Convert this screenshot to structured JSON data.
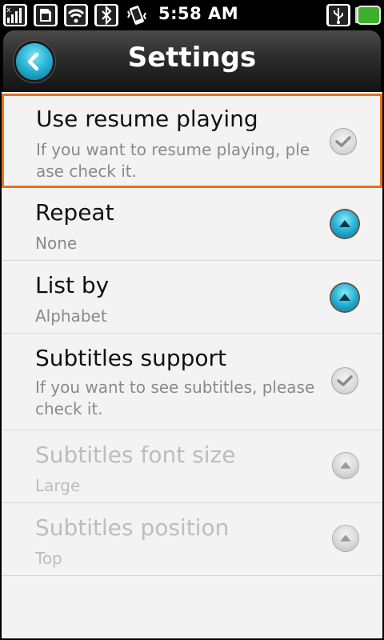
{
  "status_bar": {
    "time": "5:58 AM",
    "icons": [
      "signal-icon",
      "sim-icon",
      "wifi-icon",
      "bluetooth-icon",
      "vibrate-icon",
      "usb-icon",
      "battery-icon"
    ]
  },
  "header": {
    "title": "Settings",
    "back_icon": "back-arrow-icon",
    "accent_color": "#2bb6d9"
  },
  "settings": [
    {
      "title": "Use resume playing",
      "subtitle": "If you want to resume playing, please check it.",
      "subtitle_lines": [
        "If you want to resume playing, ple",
        "ase check it."
      ],
      "control": "checkbox",
      "enabled": true,
      "selected": true
    },
    {
      "title": "Repeat",
      "subtitle": "None",
      "subtitle_lines": [
        "None"
      ],
      "control": "dropdown",
      "enabled": true,
      "selected": false
    },
    {
      "title": "List by",
      "subtitle": "Alphabet",
      "subtitle_lines": [
        "Alphabet"
      ],
      "control": "dropdown",
      "enabled": true,
      "selected": false
    },
    {
      "title": "Subtitles support",
      "subtitle": "If you want to see subtitles, please check it.",
      "subtitle_lines": [
        "If you want to see subtitles, please",
        "check it."
      ],
      "control": "checkbox",
      "enabled": true,
      "selected": false
    },
    {
      "title": "Subtitles font size",
      "subtitle": "Large",
      "subtitle_lines": [
        "Large"
      ],
      "control": "dropdown",
      "enabled": false,
      "selected": false
    },
    {
      "title": "Subtitles position",
      "subtitle": "Top",
      "subtitle_lines": [
        "Top"
      ],
      "control": "dropdown",
      "enabled": false,
      "selected": false
    }
  ],
  "colors": {
    "selection_border": "#e8711c",
    "list_background": "#f3f3f3",
    "disabled_text": "#bdbdbd"
  }
}
